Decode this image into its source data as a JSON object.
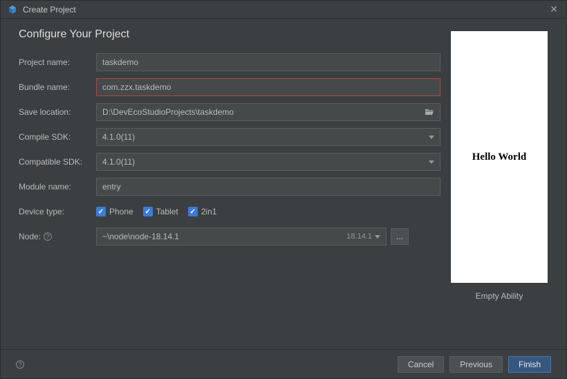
{
  "titlebar": {
    "title": "Create Project"
  },
  "heading": "Configure Your Project",
  "labels": {
    "project_name": "Project name:",
    "bundle_name": "Bundle name:",
    "save_location": "Save location:",
    "compile_sdk": "Compile SDK:",
    "compatible_sdk": "Compatible SDK:",
    "module_name": "Module name:",
    "device_type": "Device type:",
    "node": "Node:"
  },
  "values": {
    "project_name": "taskdemo",
    "bundle_name": "com.zzx.taskdemo",
    "save_location": "D:\\DevEcoStudioProjects\\taskdemo",
    "compile_sdk": "4.1.0(11)",
    "compatible_sdk": "4.1.0(11)",
    "module_name": "entry",
    "node_path": "~\\node\\node-18.14.1",
    "node_version": "18.14.1"
  },
  "device_types": {
    "phone": {
      "label": "Phone",
      "checked": true
    },
    "tablet": {
      "label": "Tablet",
      "checked": true
    },
    "two_in_one": {
      "label": "2in1",
      "checked": true
    }
  },
  "preview": {
    "text": "Hello World",
    "caption": "Empty Ability"
  },
  "footer": {
    "cancel": "Cancel",
    "previous": "Previous",
    "finish": "Finish"
  }
}
